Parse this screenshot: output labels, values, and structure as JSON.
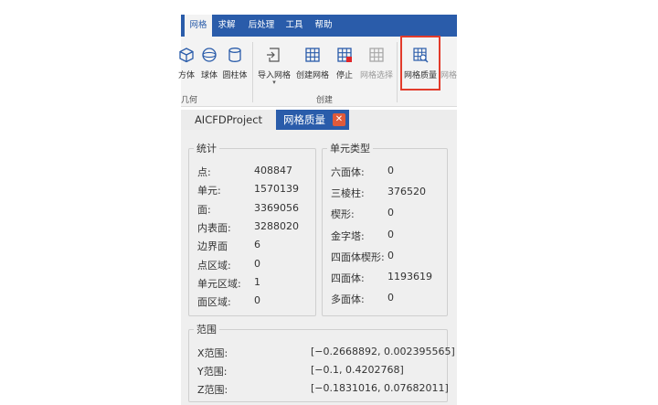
{
  "menu": {
    "items": [
      {
        "label": "网格",
        "active": true
      },
      {
        "label": "求解",
        "active": false
      },
      {
        "label": "后处理",
        "active": false
      },
      {
        "label": "工具",
        "active": false
      },
      {
        "label": "帮助",
        "active": false
      }
    ]
  },
  "ribbon": {
    "geometry_group": {
      "label": "几何",
      "buttons": [
        {
          "label": "方体",
          "icon": "cube-icon"
        },
        {
          "label": "球体",
          "icon": "sphere-icon"
        },
        {
          "label": "圆柱体",
          "icon": "cylinder-icon"
        }
      ]
    },
    "create_group": {
      "label": "创建",
      "buttons": [
        {
          "label": "导入网格",
          "icon": "import-mesh-icon"
        },
        {
          "label": "创建网格",
          "icon": "create-mesh-icon"
        },
        {
          "label": "停止",
          "icon": "stop-mesh-icon"
        },
        {
          "label": "网格选择",
          "icon": "mesh-select-icon",
          "disabled": true
        }
      ]
    },
    "quality_button": {
      "label": "网格质量",
      "icon": "mesh-quality-icon"
    },
    "trailing_label": "网格"
  },
  "tabs": [
    {
      "label": "AICFDProject",
      "active": false
    },
    {
      "label": "网格质量",
      "active": true,
      "close": "✕"
    }
  ],
  "stats": {
    "title": "统计",
    "rows": [
      {
        "label": "点:",
        "value": "408847"
      },
      {
        "label": "单元:",
        "value": "1570139"
      },
      {
        "label": "面:",
        "value": "3369056"
      },
      {
        "label": "内表面:",
        "value": "3288020"
      },
      {
        "label": "边界面",
        "value": "6"
      },
      {
        "label": "点区域:",
        "value": "0"
      },
      {
        "label": "单元区域:",
        "value": "1"
      },
      {
        "label": "面区域:",
        "value": "0"
      }
    ]
  },
  "cell_types": {
    "title": "单元类型",
    "rows": [
      {
        "label": "六面体:",
        "value": "0"
      },
      {
        "label": "三棱柱:",
        "value": "376520"
      },
      {
        "label": "楔形:",
        "value": "0"
      },
      {
        "label": "金字塔:",
        "value": "0"
      },
      {
        "label": "四面体楔形:",
        "value": "0"
      },
      {
        "label": "四面体:",
        "value": "1193619"
      },
      {
        "label": "多面体:",
        "value": "0"
      }
    ]
  },
  "range": {
    "title": "范围",
    "rows": [
      {
        "label": "X范围:",
        "value": "[−0.2668892, 0.002395565]"
      },
      {
        "label": "Y范围:",
        "value": "[−0.1, 0.4202768]"
      },
      {
        "label": "Z范围:",
        "value": "[−0.1831016, 0.07682011]"
      }
    ]
  },
  "colors": {
    "accent": "#2a5caa",
    "highlight": "#e23b2b",
    "close": "#e05a3a"
  }
}
